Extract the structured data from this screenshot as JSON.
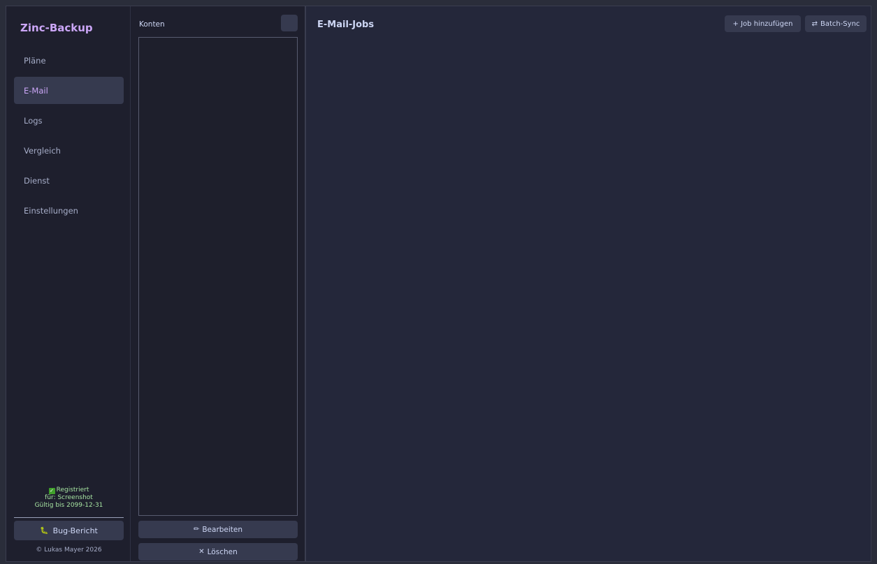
{
  "sidebar": {
    "app_title": "Zinc-Backup",
    "items": [
      {
        "label": "Pläne"
      },
      {
        "label": "E-Mail"
      },
      {
        "label": "Logs"
      },
      {
        "label": "Vergleich"
      },
      {
        "label": "Dienst"
      },
      {
        "label": "Einstellungen"
      }
    ],
    "active_item": "E-Mail",
    "registration": {
      "status": "Registriert",
      "for": "für: Screenshot",
      "valid": "Gültig bis 2099-12-31"
    },
    "bug_button": "Bug-Bericht",
    "copyright": "© Lukas Mayer 2026"
  },
  "accounts": {
    "label": "Konten",
    "edit_button": "Bearbeiten",
    "edit_icon": "✏",
    "delete_button": "Löschen",
    "delete_icon": "✕"
  },
  "main": {
    "title": "E-Mail-Jobs",
    "add_job_button": "+ Job hinzufügen",
    "batch_sync_icon": "⇄",
    "batch_sync_button": "Batch-Sync"
  },
  "colors": {
    "accent": "#cba6f7",
    "background": "#24273a",
    "panel": "#1e1f2d",
    "button": "#363a4f",
    "success": "#a6e3a1"
  }
}
